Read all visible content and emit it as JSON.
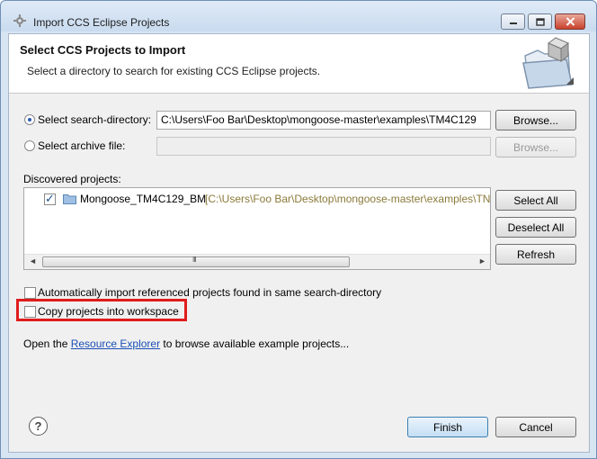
{
  "window": {
    "title": "Import CCS Eclipse Projects"
  },
  "banner": {
    "title": "Select CCS Projects to Import",
    "description": "Select a directory to search for existing CCS Eclipse projects."
  },
  "source": {
    "search_directory_label": "Select search-directory:",
    "search_directory_value": "C:\\Users\\Foo Bar\\Desktop\\mongoose-master\\examples\\TM4C129",
    "search_directory_selected": true,
    "archive_label": "Select archive file:",
    "archive_value": "",
    "browse_label": "Browse...",
    "browse_archive_label": "Browse..."
  },
  "discovered": {
    "label": "Discovered projects:",
    "projects": [
      {
        "name": "Mongoose_TM4C129_BM",
        "path": "[C:\\Users\\Foo Bar\\Desktop\\mongoose-master\\examples\\TN",
        "checked": true
      }
    ],
    "scroll_grip": "III",
    "buttons": {
      "select_all": "Select All",
      "deselect_all": "Deselect All",
      "refresh": "Refresh"
    }
  },
  "options": {
    "auto_import_label": "Automatically import referenced projects found in same search-directory",
    "auto_import_checked": false,
    "copy_label": "Copy projects into workspace",
    "copy_checked": false
  },
  "resource_explorer": {
    "prefix": "Open the ",
    "link": "Resource Explorer",
    "suffix": " to browse available example projects..."
  },
  "footer": {
    "help_icon": "?",
    "finish": "Finish",
    "cancel": "Cancel"
  },
  "colors": {
    "highlight_box": "#e01c1c",
    "link": "#1a4fb5",
    "project_path": "#8b7a3a"
  }
}
